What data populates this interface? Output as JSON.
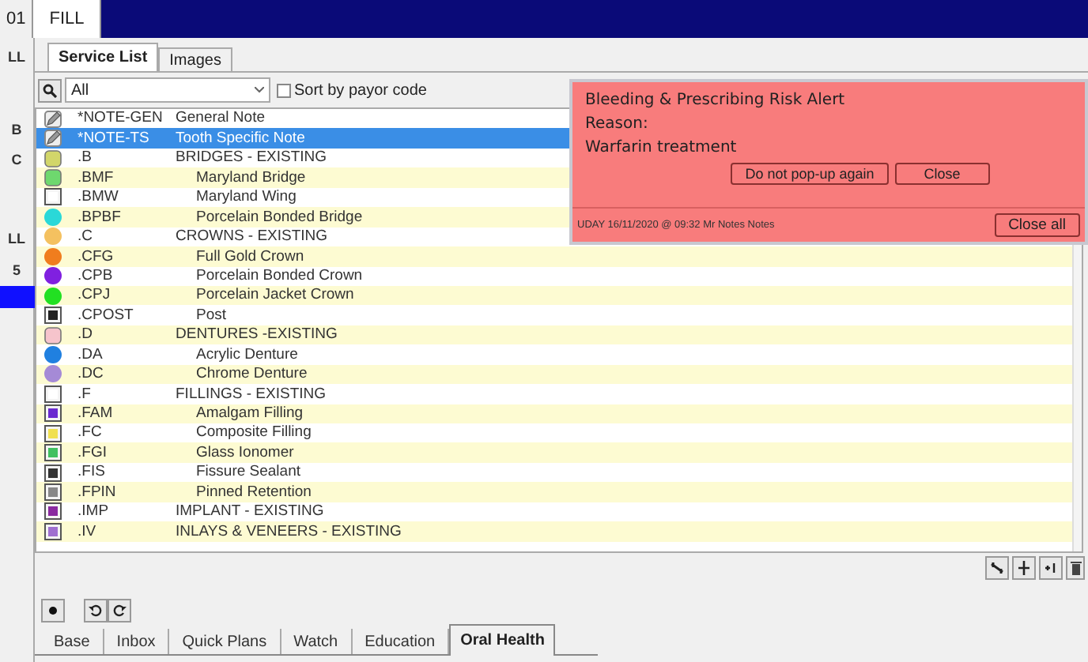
{
  "top_tabs": [
    {
      "label": "01",
      "selected": false
    },
    {
      "label": "FILL",
      "selected": true
    }
  ],
  "side_fragments": [
    "LL",
    "B",
    "C",
    "LL",
    "5"
  ],
  "tabs": [
    {
      "label": "Service List",
      "selected": true
    },
    {
      "label": "Images",
      "selected": false
    }
  ],
  "filter": {
    "value": "All",
    "sort_by_payor": {
      "label": "Sort by payor code",
      "checked": false
    }
  },
  "services": [
    {
      "code": "*NOTE-GEN",
      "description": "General Note",
      "kind": "pencil",
      "selected": false
    },
    {
      "code": "*NOTE-TS",
      "description": "Tooth Specific Note",
      "kind": "pencil",
      "selected": true
    },
    {
      "code": ".B",
      "description": "BRIDGES - EXISTING",
      "kind": "square",
      "color": "#d2d66a",
      "selected": false,
      "children": [
        {
          "code": ".BMF",
          "description": "Maryland Bridge",
          "kind": "square",
          "color": "#6ed86e",
          "selected": false
        },
        {
          "code": ".BMW",
          "description": "Maryland Wing",
          "kind": "tooth",
          "color": "#ffffff",
          "selected": false
        },
        {
          "code": ".BPBF",
          "description": "Porcelain Bonded Bridge",
          "kind": "circle",
          "color": "#2ad8d8",
          "selected": false
        }
      ]
    },
    {
      "code": ".C",
      "description": "CROWNS - EXISTING",
      "kind": "circle",
      "color": "#f4c160",
      "selected": false,
      "children": [
        {
          "code": ".CFG",
          "description": "Full Gold Crown",
          "kind": "circle",
          "color": "#f07d1e",
          "selected": false
        },
        {
          "code": ".CPB",
          "description": "Porcelain Bonded Crown",
          "kind": "circle",
          "color": "#8020e0",
          "selected": false
        },
        {
          "code": ".CPJ",
          "description": "Porcelain Jacket Crown",
          "kind": "circle",
          "color": "#22e022",
          "selected": false
        },
        {
          "code": ".CPOST",
          "description": "Post",
          "kind": "tooth",
          "color": "#222222",
          "selected": false
        }
      ]
    },
    {
      "code": ".D",
      "description": "DENTURES -EXISTING",
      "kind": "square",
      "color": "#f6c4cc",
      "selected": false,
      "children": [
        {
          "code": ".DA",
          "description": "Acrylic Denture",
          "kind": "circle",
          "color": "#2080e0",
          "selected": false
        },
        {
          "code": ".DC",
          "description": "Chrome Denture",
          "kind": "circle",
          "color": "#a58ad6",
          "selected": false
        }
      ]
    },
    {
      "code": ".F",
      "description": "FILLINGS - EXISTING",
      "kind": "tooth",
      "color": "#ffffff",
      "selected": false,
      "children": [
        {
          "code": ".FAM",
          "description": "Amalgam Filling",
          "kind": "tooth",
          "color": "#6a2ad0",
          "selected": false
        },
        {
          "code": ".FC",
          "description": "Composite Filling",
          "kind": "tooth",
          "color": "#f0e050",
          "selected": false
        },
        {
          "code": ".FGI",
          "description": "Glass Ionomer",
          "kind": "tooth",
          "color": "#40c060",
          "selected": false
        },
        {
          "code": ".FIS",
          "description": "Fissure Sealant",
          "kind": "tooth",
          "color": "#333333",
          "selected": false
        },
        {
          "code": ".FPIN",
          "description": "Pinned Retention",
          "kind": "tooth",
          "color": "#888888",
          "selected": false
        }
      ]
    },
    {
      "code": ".IMP",
      "description": "IMPLANT - EXISTING",
      "kind": "tooth",
      "color": "#8a2aa0",
      "selected": false
    },
    {
      "code": ".IV",
      "description": "INLAYS & VENEERS - EXISTING",
      "kind": "tooth",
      "color": "#a070d0",
      "selected": false
    }
  ],
  "alert": {
    "title": "Bleeding & Prescribing Risk Alert",
    "lines": [
      "Reason:",
      "Warfarin treatment"
    ],
    "buttons": [
      "Do not pop-up again",
      "Close"
    ],
    "footer": "UDAY 16/11/2020 @ 09:32 Mr Notes Notes",
    "close_all": "Close all"
  },
  "bottom_tabs": [
    {
      "label": "Base",
      "selected": false
    },
    {
      "label": "Inbox",
      "selected": false
    },
    {
      "label": "Quick Plans",
      "selected": false
    },
    {
      "label": "Watch",
      "selected": false
    },
    {
      "label": "Education",
      "selected": false
    },
    {
      "label": "Oral Health",
      "selected": true
    }
  ]
}
